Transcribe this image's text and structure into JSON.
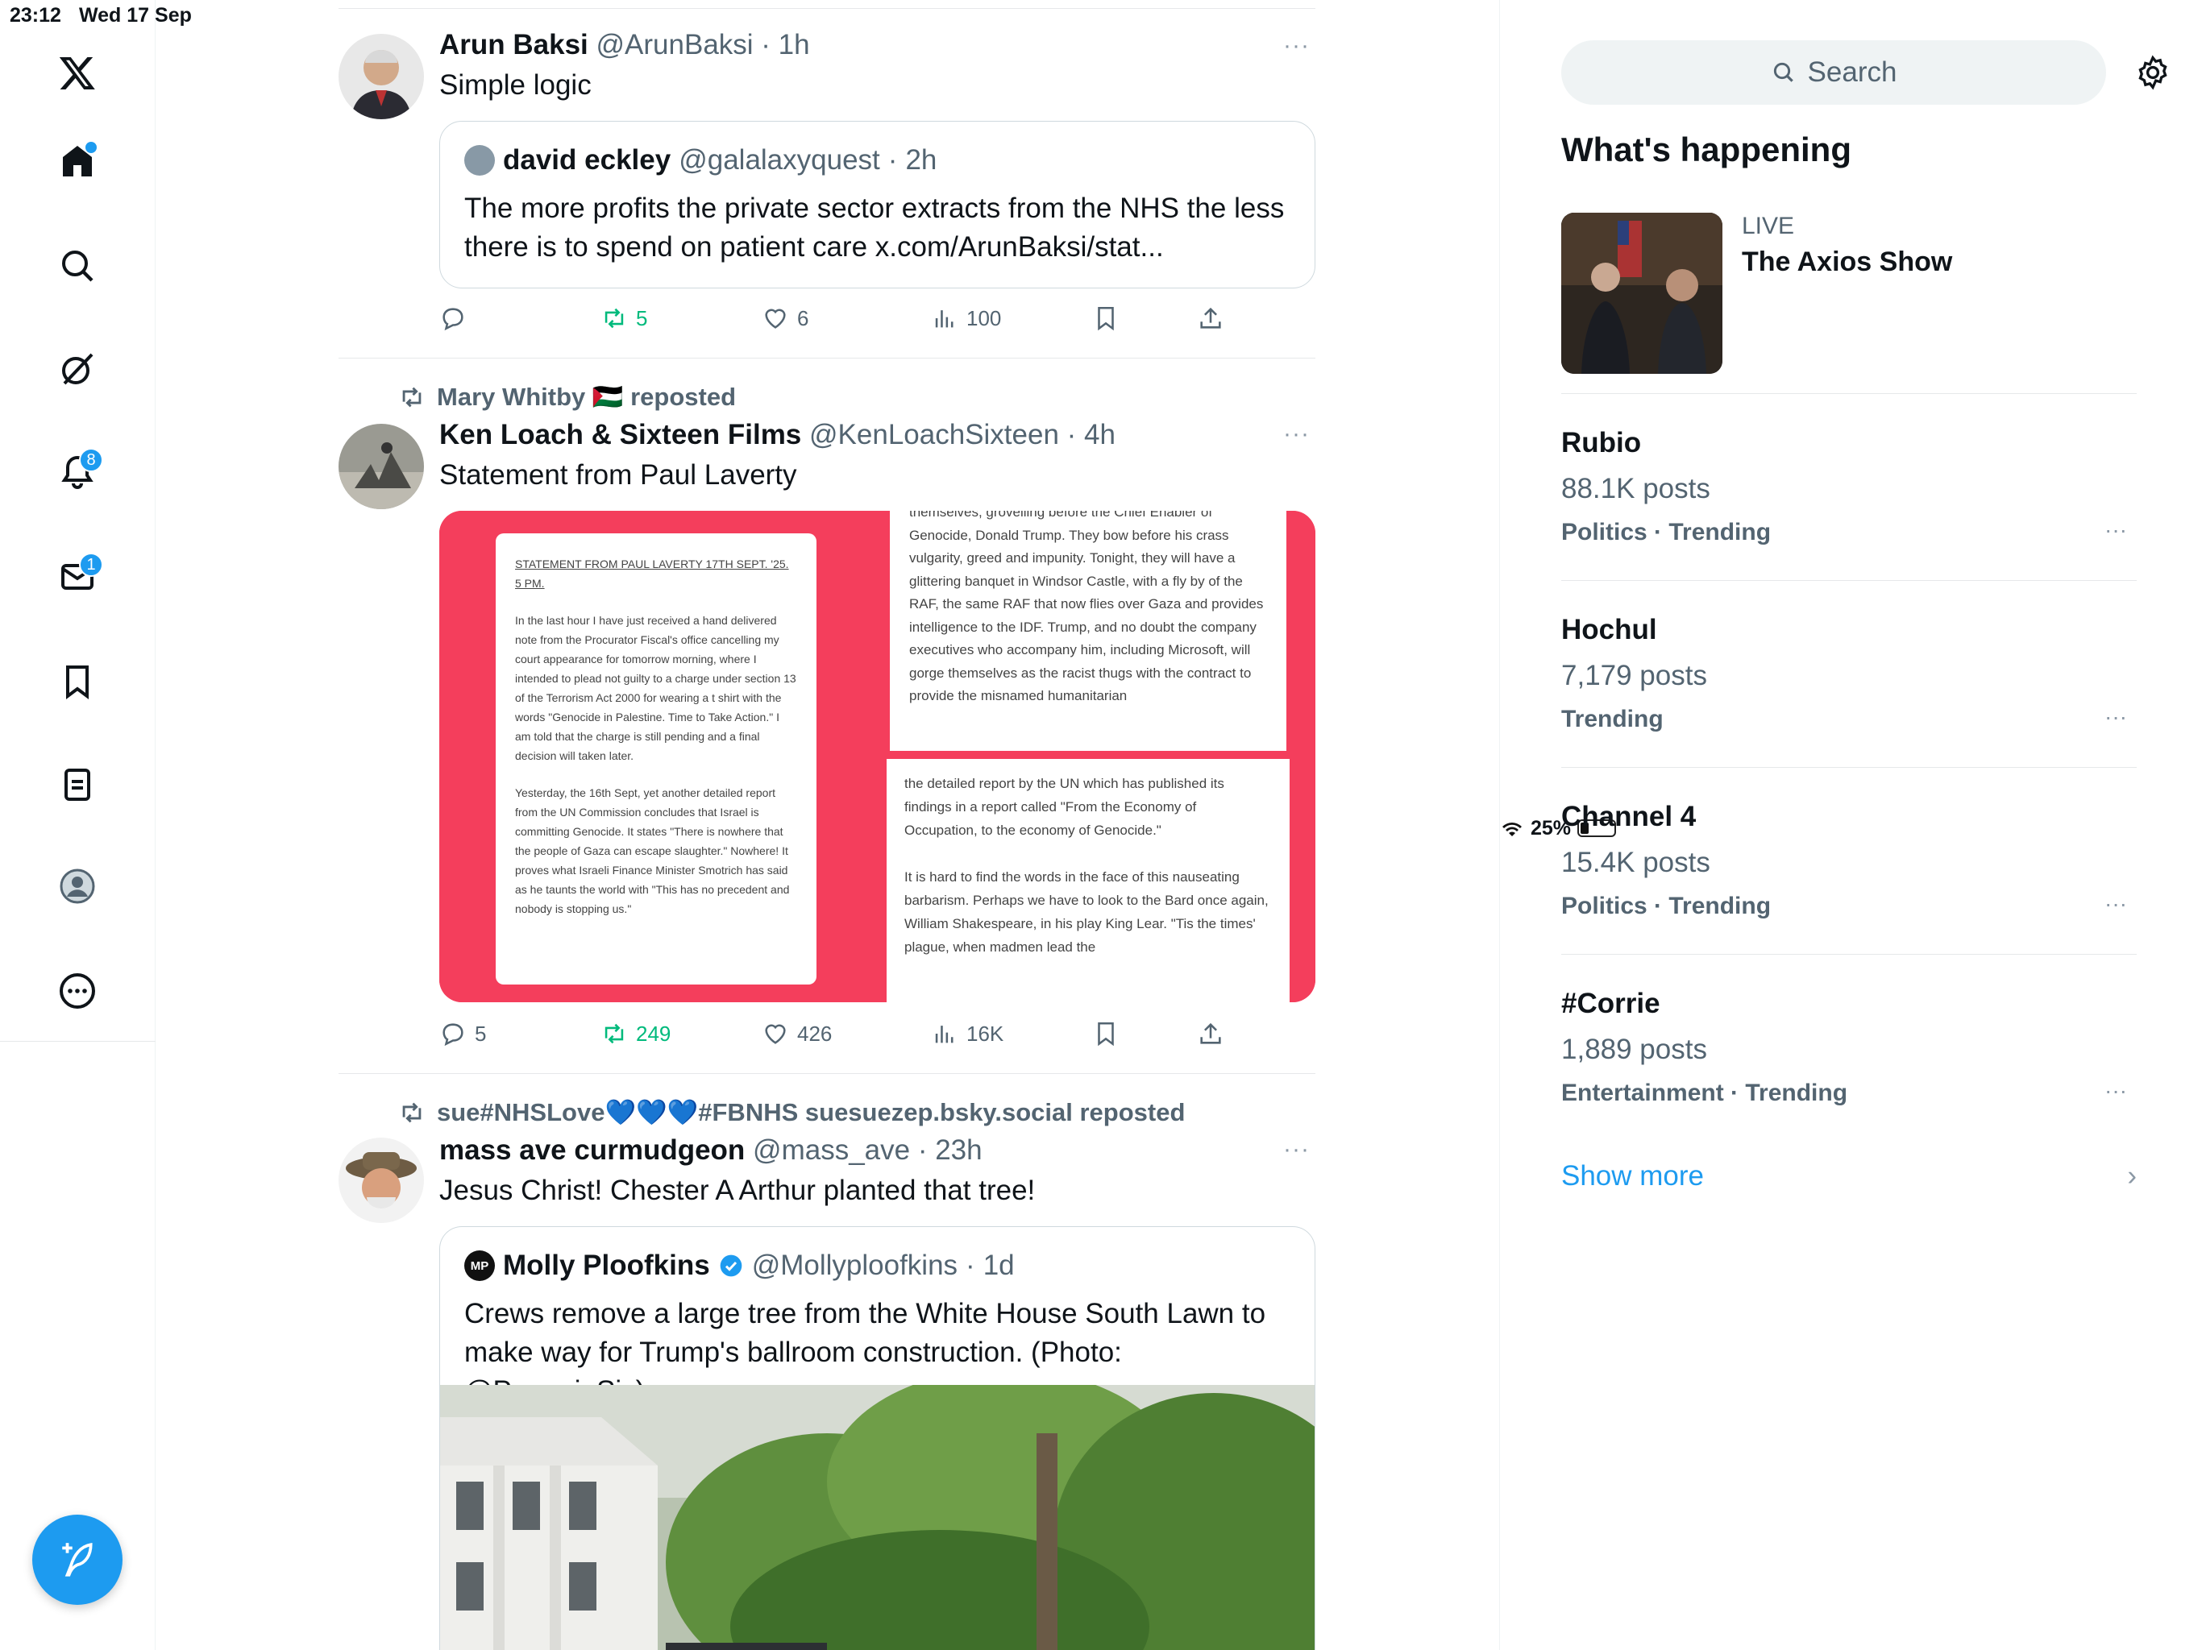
{
  "status_bar": {
    "time": "23:12",
    "date": "Wed 17 Sep",
    "battery": "25%",
    "battery_level": 0.25
  },
  "nav": {
    "notifications_badge": "8",
    "messages_badge": "1"
  },
  "tweets": [
    {
      "name": "Arun Baksi",
      "handle": "@ArunBaksi",
      "time": "1h",
      "text": "Simple logic",
      "quote": {
        "name": "david eckley",
        "handle": "@galalaxyquest",
        "time": "2h",
        "text": "The more profits the private sector extracts from the NHS the less there is to spend on patient care x.com/ArunBaksi/stat..."
      },
      "actions": {
        "replies": "",
        "reposts": "5",
        "likes": "6",
        "views": "100"
      }
    },
    {
      "reposted_by": "Mary Whitby 🇵🇸 reposted",
      "name": "Ken Loach & Sixteen Films",
      "handle": "@KenLoachSixteen",
      "time": "4h",
      "text": "Statement from Paul Laverty",
      "media": {
        "doc_left_heading": "STATEMENT FROM PAUL LAVERTY 17TH SEPT. '25. 5 PM.",
        "doc_left_p1": "In the last hour I have just received a hand delivered note from the Procurator Fiscal's office cancelling my court appearance for tomorrow morning, where I intended to plead not guilty to a charge under section 13 of the Terrorism Act 2000 for wearing a t shirt with the words \"Genocide in Palestine. Time to Take Action.\" I am told that the charge is still pending and a final decision will taken later.",
        "doc_left_p2": "Yesterday, the 16th Sept, yet another detailed report from the UN Commission concludes that Israel is committing Genocide. It states \"There is nowhere that the people of Gaza can escape slaughter.\" Nowhere! It proves what Israeli Finance Minister Smotrich has said as he taunts the world with \"This has no precedent and nobody is stopping us.\"",
        "doc_right_top": "themselves, grovelling before the Chief Enabler of Genocide, Donald Trump. They bow before his crass vulgarity, greed and impunity. Tonight, they will have a glittering banquet in Windsor Castle, with a fly by of the RAF, the same RAF that now flies over Gaza and provides intelligence to the IDF. Trump, and no doubt the company executives who accompany him, including Microsoft, will gorge themselves as the racist thugs with the contract to provide the misnamed humanitarian",
        "doc_right_bottom_p1": "the detailed report by the UN which has published its findings in a report called \"From the Economy of Occupation, to the economy of Genocide.\"",
        "doc_right_bottom_p2": "It is hard to find the words in the face of this nauseating barbarism. Perhaps we have to look to the Bard once again, William Shakespeare, in his play King Lear. \"Tis the times' plague, when madmen lead the"
      },
      "actions": {
        "replies": "5",
        "reposts": "249",
        "likes": "426",
        "views": "16K"
      }
    },
    {
      "reposted_by": "sue#NHSLove💙💙💙#FBNHS suesuezep.bsky.social reposted",
      "name": "mass ave curmudgeon",
      "handle": "@mass_ave",
      "time": "23h",
      "text": "Jesus Christ! Chester A Arthur planted that tree!",
      "quote": {
        "avatar_initials": "MP",
        "name": "Molly Ploofkins",
        "handle": "@Mollyploofkins",
        "time": "1d",
        "text": "Crews remove a large tree from the White House South Lawn to make way for Trump's ballroom construction. (Photo: @PenguinSix)"
      }
    }
  ],
  "sidebar": {
    "search_placeholder": "Search",
    "whats_happening": "What's happening",
    "live_label": "LIVE",
    "live_title": "The Axios Show",
    "trends": [
      {
        "name": "Rubio",
        "posts": "88.1K posts",
        "category": "Politics · Trending"
      },
      {
        "name": "Hochul",
        "posts": "7,179 posts",
        "category": "Trending"
      },
      {
        "name": "Channel 4",
        "posts": "15.4K posts",
        "category": "Politics · Trending"
      },
      {
        "name": "#Corrie",
        "posts": "1,889 posts",
        "category": "Entertainment · Trending"
      }
    ],
    "show_more": "Show more"
  },
  "colors": {
    "accent": "#1d9bf0",
    "repost_green": "#00ba7c",
    "secondary_text": "#536471",
    "media_red": "#f43e5c"
  },
  "icons": [
    "x-logo-icon",
    "home-icon",
    "search-icon",
    "grok-icon",
    "bell-icon",
    "mail-icon",
    "bookmark-icon",
    "lists-icon",
    "profile-icon",
    "more-circle-icon",
    "compose-icon",
    "reply-icon",
    "repost-icon",
    "like-icon",
    "views-icon",
    "share-icon",
    "gear-icon",
    "verified-icon",
    "wifi-icon",
    "battery-icon"
  ]
}
